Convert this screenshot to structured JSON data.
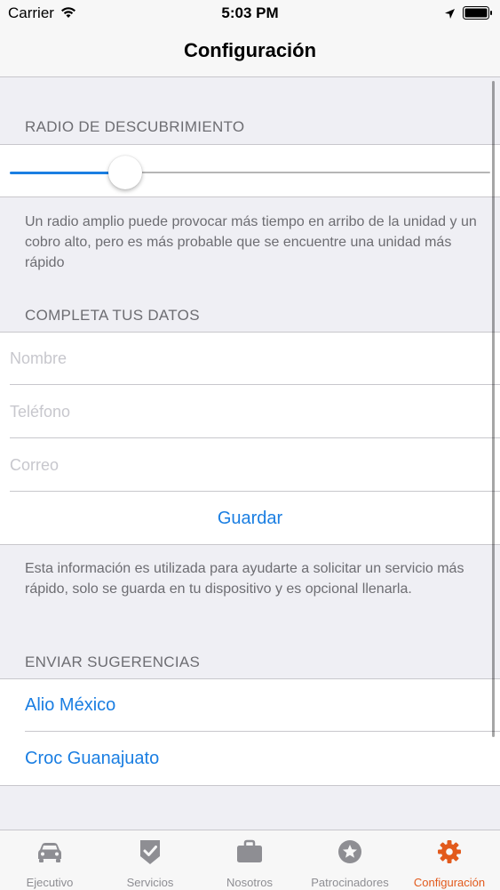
{
  "status_bar": {
    "carrier": "Carrier",
    "time": "5:03 PM",
    "icons": [
      "wifi-icon",
      "location-arrow-icon",
      "battery-icon"
    ]
  },
  "nav": {
    "title": "Configuración"
  },
  "discovery": {
    "header": "RADIO DE DESCUBRIMIENTO",
    "slider_value": 0.22,
    "footer": "Un radio amplio puede provocar más tiempo en arribo de la unidad y un cobro alto, pero es más probable que se encuentre una unidad más rápido"
  },
  "form": {
    "header": "COMPLETA TUS DATOS",
    "fields": {
      "name": {
        "placeholder": "Nombre",
        "value": ""
      },
      "phone": {
        "placeholder": "Teléfono",
        "value": ""
      },
      "email": {
        "placeholder": "Correo",
        "value": ""
      }
    },
    "save_label": "Guardar",
    "footer": "Esta información es utilizada para ayudarte a solicitar un servicio más rápido, solo se guarda en tu dispositivo y es opcional llenarla."
  },
  "suggestions": {
    "header": "ENVIAR SUGERENCIAS",
    "links": [
      "Alio México",
      "Croc Guanajuato"
    ]
  },
  "tab_bar": {
    "tabs": [
      {
        "label": "Ejecutivo",
        "icon": "car-icon"
      },
      {
        "label": "Servicios",
        "icon": "shield-check-icon"
      },
      {
        "label": "Nosotros",
        "icon": "briefcase-icon"
      },
      {
        "label": "Patrocinadores",
        "icon": "star-badge-icon"
      },
      {
        "label": "Configuración",
        "icon": "gear-icon"
      }
    ],
    "active_index": 4
  },
  "colors": {
    "accent": "#1a7ee2",
    "active_tab": "#e25a1c",
    "inactive_tab": "#8e8e93",
    "background": "#efeff4"
  }
}
